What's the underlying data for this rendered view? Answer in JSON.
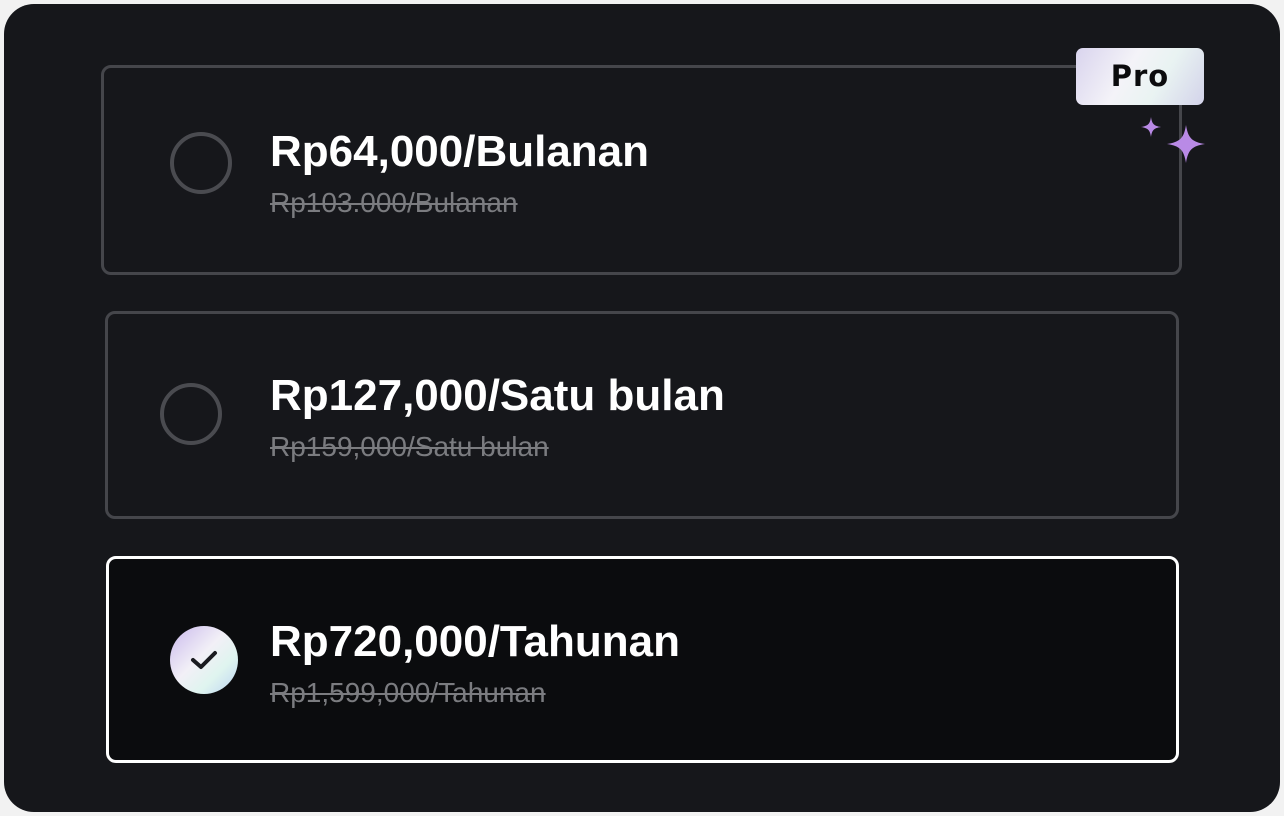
{
  "badge": {
    "label": "Pro",
    "icon": "sparkle-icon"
  },
  "plans": [
    {
      "price": "Rp64,000/Bulanan",
      "original_price": "Rp103.000/Bulanan",
      "selected": false
    },
    {
      "price": "Rp127,000/Satu bulan",
      "original_price": "Rp159,000/Satu bulan",
      "selected": false
    },
    {
      "price": "Rp720,000/Tahunan",
      "original_price": "Rp1,599,000/Tahunan",
      "selected": true
    }
  ],
  "colors": {
    "background": "#16171b",
    "selected_border": "#ffffff",
    "unselected_border": "#45464b",
    "strikethrough_text": "#7b7c80",
    "sparkle": "#b98ae6"
  }
}
